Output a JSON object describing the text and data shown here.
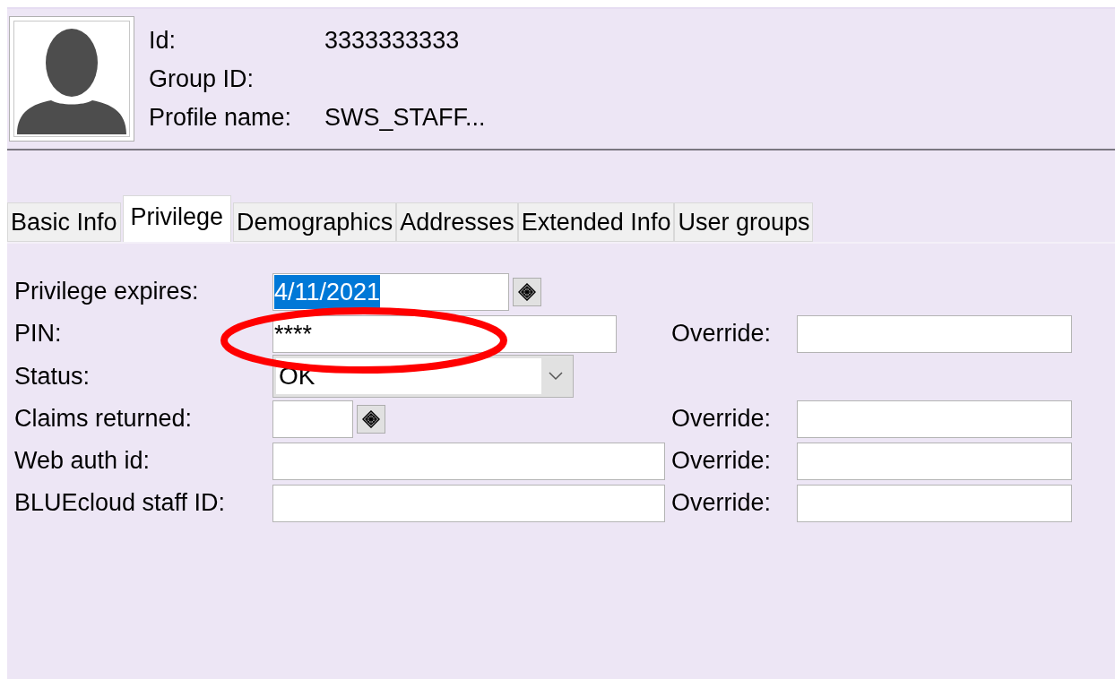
{
  "header": {
    "fields": [
      {
        "label": "Id:",
        "value": "3333333333"
      },
      {
        "label": "Group ID:"
      },
      {
        "label": "Profile name:",
        "value": "SWS_STAFF..."
      }
    ]
  },
  "tabs": [
    {
      "label": "Basic Info",
      "selected": false
    },
    {
      "label": "Privilege",
      "selected": true
    },
    {
      "label": "Demographics",
      "selected": false
    },
    {
      "label": "Addresses",
      "selected": false
    },
    {
      "label": "Extended Info",
      "selected": false
    },
    {
      "label": "User groups",
      "selected": false
    }
  ],
  "form": {
    "rows": [
      {
        "kind": "date",
        "label": "Privilege expires:",
        "value": "4/11/2021",
        "value_selected": true
      },
      {
        "kind": "text",
        "label": "PIN:",
        "value": "****",
        "override": {
          "label": "Override:"
        }
      },
      {
        "kind": "select",
        "label": "Status:",
        "value": "OK"
      },
      {
        "kind": "counter",
        "label": "Claims returned:",
        "override": {
          "label": "Override:"
        }
      },
      {
        "kind": "wide",
        "label": "Web auth id:",
        "override": {
          "label": "Override:"
        }
      },
      {
        "kind": "wide",
        "label": "BLUEcloud staff ID:",
        "override": {
          "label": "Override:"
        }
      }
    ]
  }
}
